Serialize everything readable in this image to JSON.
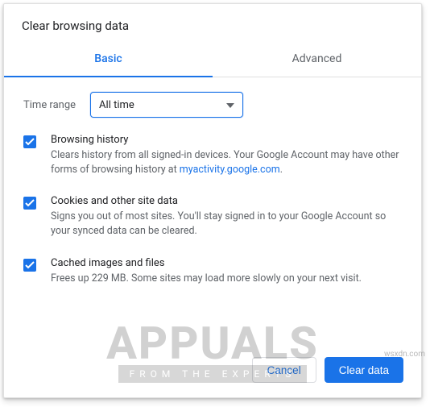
{
  "title": "Clear browsing data",
  "tabs": {
    "basic": "Basic",
    "advanced": "Advanced"
  },
  "time_range": {
    "label": "Time range",
    "value": "All time"
  },
  "options": [
    {
      "title": "Browsing history",
      "desc_prefix": "Clears history from all signed-in devices. Your Google Account may have other forms of browsing history at ",
      "link_text": "myactivity.google.com",
      "desc_suffix": "."
    },
    {
      "title": "Cookies and other site data",
      "desc": "Signs you out of most sites. You'll stay signed in to your Google Account so your synced data can be cleared."
    },
    {
      "title": "Cached images and files",
      "desc": "Frees up 229 MB. Some sites may load more slowly on your next visit."
    }
  ],
  "buttons": {
    "cancel": "Cancel",
    "clear": "Clear data"
  },
  "watermark": {
    "big": "APPUALS",
    "small": "FROM THE EXPERTS",
    "src": "wsxdn.com"
  }
}
